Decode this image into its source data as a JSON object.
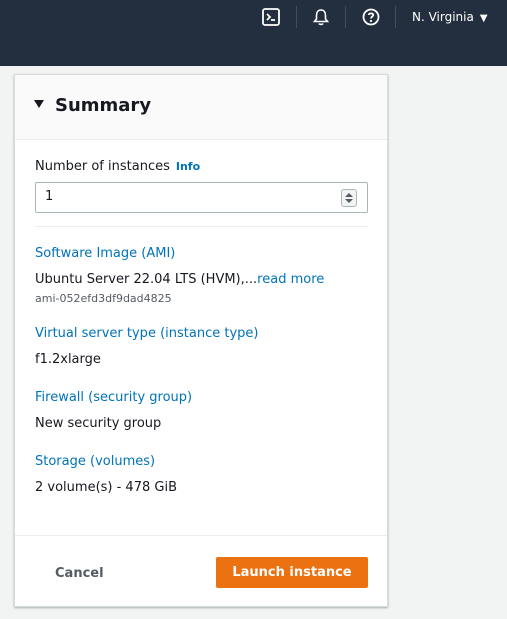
{
  "topbar": {
    "icons": [
      "cloudshell-icon",
      "bell-icon",
      "help-icon"
    ],
    "region": "N. Virginia"
  },
  "summary": {
    "title": "Summary",
    "instances_label": "Number of instances",
    "info_label": "Info",
    "instances_value": "1",
    "ami": {
      "label": "Software Image (AMI)",
      "value": "Ubuntu Server 22.04 LTS (HVM),...",
      "read_more": "read more",
      "id": "ami-052efd3df9dad4825"
    },
    "instance_type": {
      "label": "Virtual server type (instance type)",
      "value": "f1.2xlarge"
    },
    "firewall": {
      "label": "Firewall (security group)",
      "value": "New security group"
    },
    "storage": {
      "label": "Storage (volumes)",
      "value": "2 volume(s) - 478 GiB"
    },
    "cancel_label": "Cancel",
    "launch_label": "Launch instance"
  },
  "colors": {
    "topbar": "#232f3e",
    "link": "#0073bb",
    "primary_button": "#ec7211"
  }
}
